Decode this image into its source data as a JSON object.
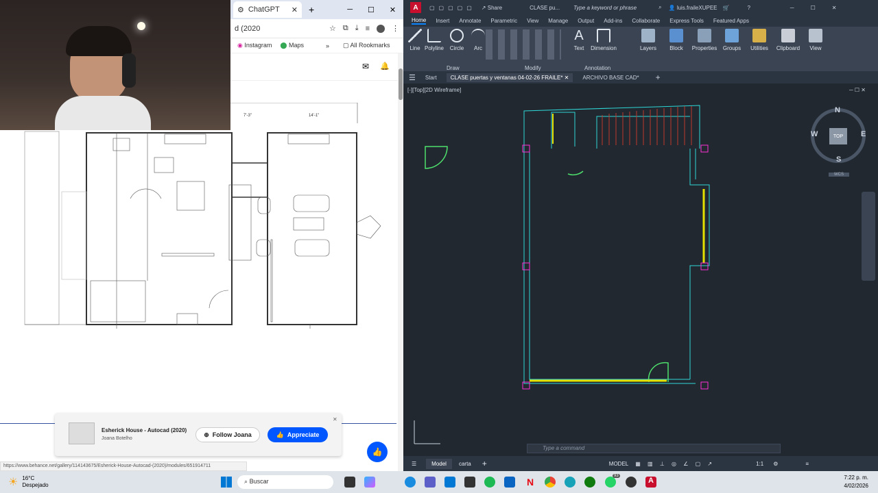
{
  "browser": {
    "tab_title": "ChatGPT",
    "address": "d (2020",
    "bookmarks": [
      "Instagram",
      "Maps",
      "All Rookmarks"
    ],
    "status_url": "https://www.behance.net/gallery/114143675/Esherick-House-Autocad-(2020)/modules/651914711",
    "card": {
      "title": "Esherick House - Autocad (2020)",
      "author": "Joana Botelho",
      "follow_label": "Follow Joana",
      "appreciate_label": "Appreciate"
    },
    "dims": [
      "7'-3\"",
      "14'-1\""
    ]
  },
  "autocad": {
    "app_letter": "A",
    "share": "Share",
    "doc_short": "CLASE pu...",
    "search_placeholder": "Type a keyword or phrase",
    "user": "luis.fraileXUPEE",
    "menu_tabs": [
      "Home",
      "Insert",
      "Annotate",
      "Parametric",
      "View",
      "Manage",
      "Output",
      "Add-ins",
      "Collaborate",
      "Express Tools",
      "Featured Apps"
    ],
    "draw_tools": [
      "Line",
      "Polyline",
      "Circle",
      "Arc"
    ],
    "tools_right": [
      "Text",
      "Dimension",
      "Layers",
      "Block",
      "Properties",
      "Groups",
      "Utilities",
      "Clipboard",
      "View"
    ],
    "panel_labels": [
      "Draw",
      "Modify",
      "Annotation"
    ],
    "doc_tabs": [
      "Start",
      "CLASE puertas y ventanas 04-02-26 FRAILE*",
      "ARCHIVO BASE CAD*"
    ],
    "viewport_label": "[-][Top][2D Wireframe]",
    "viewcube": {
      "n": "N",
      "s": "S",
      "e": "E",
      "w": "W",
      "top": "TOP",
      "wcs": "WCS"
    },
    "command_placeholder": "Type a command",
    "layout_tabs": [
      "Model",
      "carta"
    ],
    "model_label": "MODEL",
    "scale": "1:1"
  },
  "taskbar": {
    "temp": "16°C",
    "weather": "Despejado",
    "search": "Buscar",
    "time": "7:22 p. m.",
    "date": "4/02/2026",
    "badge": "93"
  },
  "colors": {
    "accent": "#0a84ff",
    "cad_bg": "#212830",
    "appreciate": "#0057ff"
  }
}
